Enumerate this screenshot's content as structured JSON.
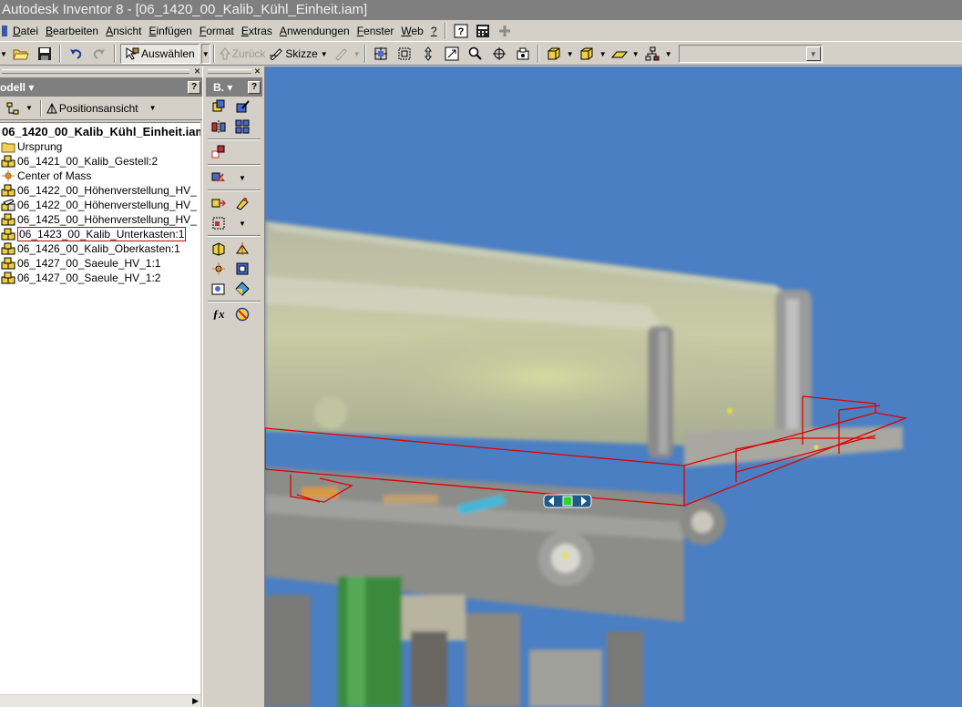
{
  "window": {
    "title": "Autodesk Inventor 8 - [06_1420_00_Kalib_Kühl_Einheit.iam]"
  },
  "menu": {
    "items": [
      {
        "name": "menu-datei",
        "label": "Datei"
      },
      {
        "name": "menu-bearbeiten",
        "label": "Bearbeiten"
      },
      {
        "name": "menu-ansicht",
        "label": "Ansicht"
      },
      {
        "name": "menu-einfuegen",
        "label": "Einfügen"
      },
      {
        "name": "menu-format",
        "label": "Format"
      },
      {
        "name": "menu-extras",
        "label": "Extras"
      },
      {
        "name": "menu-anwendungen",
        "label": "Anwendungen"
      },
      {
        "name": "menu-fenster",
        "label": "Fenster"
      },
      {
        "name": "menu-web",
        "label": "Web"
      },
      {
        "name": "menu-help",
        "label": "?"
      }
    ]
  },
  "toolbar": {
    "select_label": "Auswählen",
    "back_label": "Zurück",
    "sketch_label": "Skizze",
    "combo_value": ""
  },
  "browser": {
    "header": "odell",
    "view_label": "Positionsansicht",
    "root": "06_1420_00_Kalib_Kühl_Einheit.iam",
    "items": [
      {
        "label": "Ursprung",
        "icon": "folder-icon",
        "selected": false
      },
      {
        "label": "06_1421_00_Kalib_Gestell:2",
        "icon": "assembly-icon",
        "selected": false
      },
      {
        "label": "Center of Mass",
        "icon": "center-of-mass-icon",
        "selected": false
      },
      {
        "label": "06_1422_00_Höhenverstellung_HV_",
        "icon": "assembly-icon",
        "selected": false
      },
      {
        "label": "06_1422_00_Höhenverstellung_HV_",
        "icon": "adaptive-assembly-icon",
        "selected": false
      },
      {
        "label": "06_1425_00_Höhenverstellung_HV_",
        "icon": "assembly-icon",
        "selected": false
      },
      {
        "label": "06_1423_00_Kalib_Unterkasten:1",
        "icon": "assembly-icon",
        "selected": true
      },
      {
        "label": "06_1426_00_Kalib_Oberkasten:1",
        "icon": "assembly-icon",
        "selected": false
      },
      {
        "label": "06_1427_00_Saeule_HV_1:1",
        "icon": "assembly-icon",
        "selected": false
      },
      {
        "label": "06_1427_00_Saeule_HV_1:2",
        "icon": "assembly-icon",
        "selected": false
      }
    ]
  },
  "panelbar": {
    "header": "B."
  },
  "colors": {
    "title_bg": "#7f7f7f",
    "viewport_bg": "#4b7fc3",
    "highlight": "#e00000",
    "frame_gray": "#9a9a96",
    "column_green": "#3a8a3a"
  }
}
